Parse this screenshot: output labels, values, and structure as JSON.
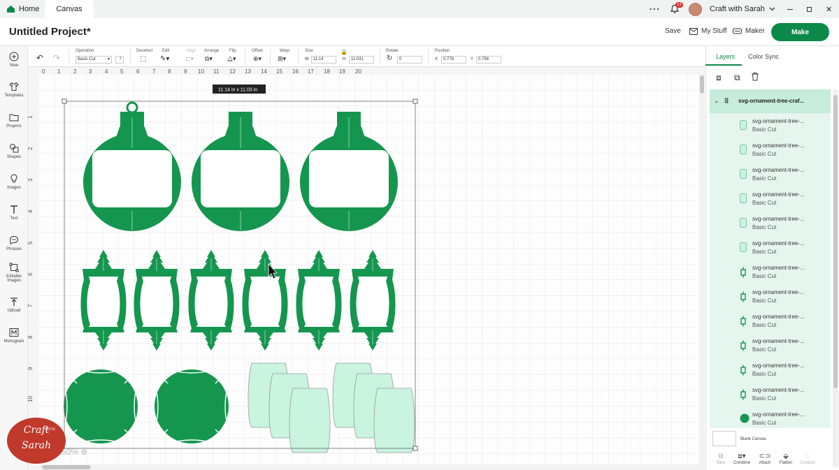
{
  "tabs": {
    "home": "Home",
    "canvas": "Canvas"
  },
  "titlebar": {
    "notification_count": "13",
    "account_name": "Craft with Sarah"
  },
  "header": {
    "project_title": "Untitled Project*",
    "save": "Save",
    "my_stuff": "My Stuff",
    "maker": "Maker",
    "make": "Make"
  },
  "left_nav": [
    {
      "label": "New",
      "icon": "plus-circle-icon"
    },
    {
      "label": "Templates",
      "icon": "shirt-icon"
    },
    {
      "label": "Projects",
      "icon": "folder-icon"
    },
    {
      "label": "Shapes",
      "icon": "shapes-icon"
    },
    {
      "label": "Images",
      "icon": "lightbulb-icon"
    },
    {
      "label": "Text",
      "icon": "text-icon"
    },
    {
      "label": "Phrases",
      "icon": "speech-bubble-icon"
    },
    {
      "label": "Editable Images",
      "icon": "editable-image-icon"
    },
    {
      "label": "Upload",
      "icon": "upload-icon"
    },
    {
      "label": "Monogram",
      "icon": "monogram-icon"
    }
  ],
  "toolbar": {
    "operation_label": "Operation",
    "operation_value": "Basic Cut",
    "deselect": "Deselect",
    "edit": "Edit",
    "align": "Align",
    "arrange": "Arrange",
    "flip": "Flip",
    "offset": "Offset",
    "warp": "Warp",
    "size": "Size",
    "w_label": "W",
    "w_value": "11.14",
    "h_label": "H",
    "h_value": "11.031",
    "rotate": "Rotate",
    "rotate_value": "0",
    "position": "Position",
    "x_label": "X",
    "x_value": "0.778",
    "y_label": "Y",
    "y_value": "0.758"
  },
  "canvas": {
    "size_tooltip": "11.14  in x 11.03  in",
    "ruler_top": [
      "0",
      "1",
      "2",
      "3",
      "4",
      "5",
      "6",
      "7",
      "8",
      "9",
      "10",
      "11",
      "12",
      "13",
      "14",
      "15",
      "16",
      "17",
      "18",
      "19",
      "20"
    ],
    "ruler_left": [
      "1",
      "2",
      "3",
      "4",
      "5",
      "6",
      "7",
      "8",
      "9",
      "10"
    ],
    "zoom": "50%"
  },
  "right_panel": {
    "tab_layers": "Layers",
    "tab_color_sync": "Color Sync",
    "group_name": "svg-ornament-tree-craf...",
    "layers": [
      {
        "name": "svg-ornament-tree-...",
        "op": "Basic Cut",
        "thumb": "rect"
      },
      {
        "name": "svg-ornament-tree-...",
        "op": "Basic Cut",
        "thumb": "rect"
      },
      {
        "name": "svg-ornament-tree-...",
        "op": "Basic Cut",
        "thumb": "rect"
      },
      {
        "name": "svg-ornament-tree-...",
        "op": "Basic Cut",
        "thumb": "rect"
      },
      {
        "name": "svg-ornament-tree-...",
        "op": "Basic Cut",
        "thumb": "rect"
      },
      {
        "name": "svg-ornament-tree-...",
        "op": "Basic Cut",
        "thumb": "rect"
      },
      {
        "name": "svg-ornament-tree-...",
        "op": "Basic Cut",
        "thumb": "ornament"
      },
      {
        "name": "svg-ornament-tree-...",
        "op": "Basic Cut",
        "thumb": "ornament"
      },
      {
        "name": "svg-ornament-tree-...",
        "op": "Basic Cut",
        "thumb": "ornament"
      },
      {
        "name": "svg-ornament-tree-...",
        "op": "Basic Cut",
        "thumb": "ornament"
      },
      {
        "name": "svg-ornament-tree-...",
        "op": "Basic Cut",
        "thumb": "ornament"
      },
      {
        "name": "svg-ornament-tree-...",
        "op": "Basic Cut",
        "thumb": "ornament"
      },
      {
        "name": "svg-ornament-tree-...",
        "op": "Basic Cut",
        "thumb": "circle"
      }
    ],
    "blank_canvas": "Blank Canvas",
    "bottom_tools": [
      "Slice",
      "Combine",
      "Attach",
      "Flatten",
      "Contour"
    ]
  },
  "logo": {
    "line1": "Craft",
    "with": "WITH",
    "line2": "Sarah"
  },
  "colors": {
    "brand_green": "#0b8a4a",
    "mint": "#c8f4e0",
    "selected_layer": "#c6ecdb"
  }
}
